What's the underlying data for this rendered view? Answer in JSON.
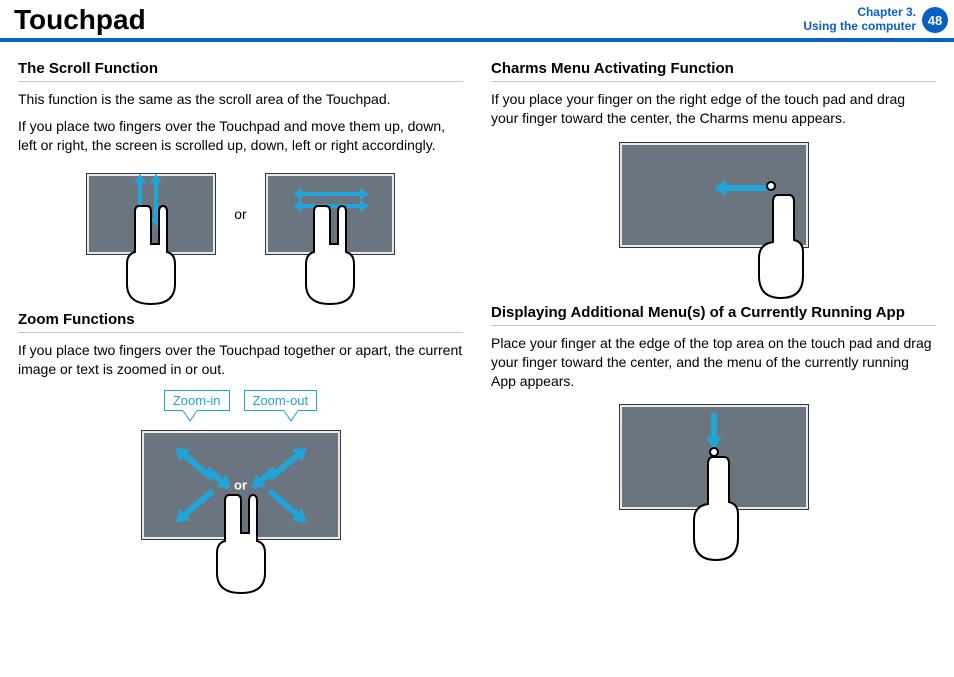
{
  "header": {
    "page_title": "Touchpad",
    "chapter_line1": "Chapter 3.",
    "chapter_line2": "Using the computer",
    "page_number": "48"
  },
  "left": {
    "scroll": {
      "title": "The Scroll Function",
      "p1": "This function is the same as the scroll area of the Touchpad.",
      "p2": "If you place two fingers over the Touchpad and move them up, down, left or right, the screen is scrolled up, down, left or right accordingly.",
      "between_label": "or"
    },
    "zoom": {
      "title": "Zoom Functions",
      "p1": "If you place two fingers over the Touchpad together or apart, the current image or text is zoomed in or out.",
      "zoom_in_label": "Zoom-in",
      "zoom_out_label": "Zoom-out",
      "center_label": "or"
    }
  },
  "right": {
    "charms": {
      "title": "Charms Menu Activating Function",
      "p1": "If you place your finger on the right edge of the touch pad and drag your finger toward the center, the Charms menu appears."
    },
    "appmenu": {
      "title": "Displaying Additional Menu(s) of a Currently Running App",
      "p1": "Place your finger at the edge of the top area on the touch pad and drag your finger toward the center, and the menu of the currently running App appears."
    }
  }
}
